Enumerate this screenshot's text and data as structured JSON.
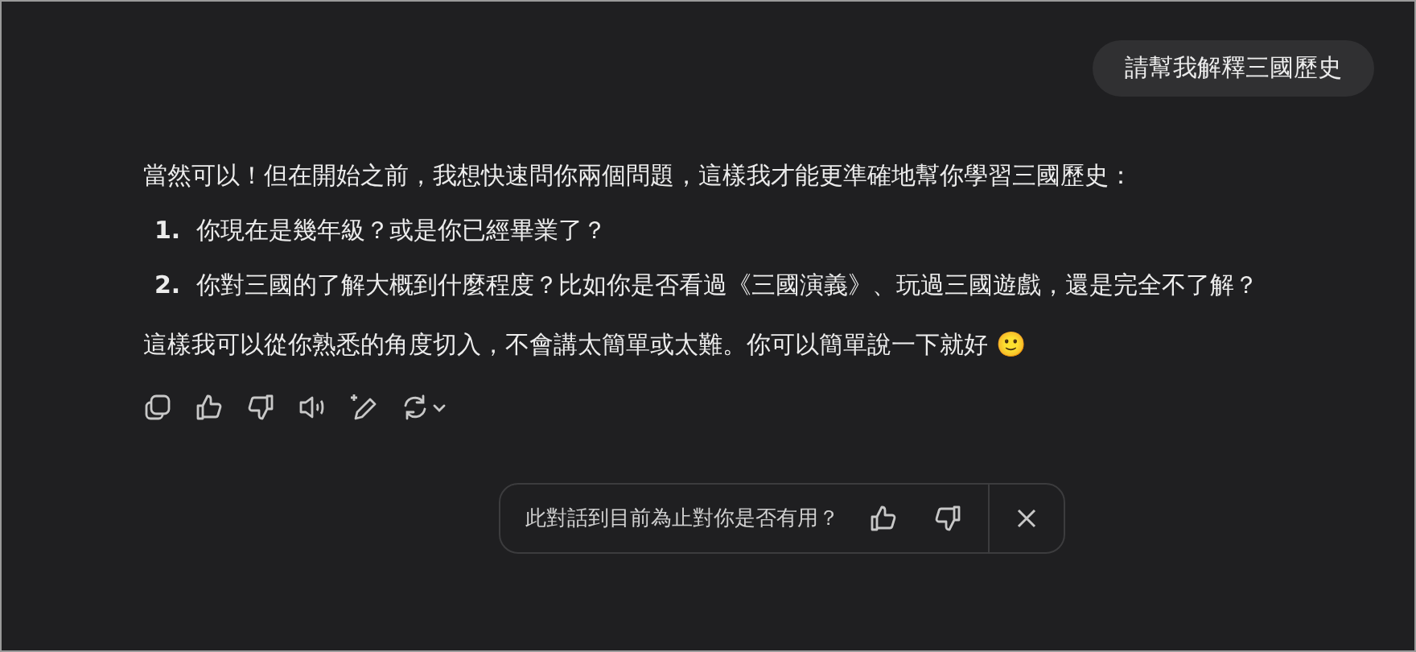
{
  "user_message": {
    "text": "請幫我解釋三國歷史"
  },
  "assistant_message": {
    "intro": "當然可以！但在開始之前，我想快速問你兩個問題，這樣我才能更準確地幫你學習三國歷史：",
    "questions": [
      {
        "number": "1.",
        "text": "你現在是幾年級？或是你已經畢業了？"
      },
      {
        "number": "2.",
        "text": "你對三國的了解大概到什麼程度？比如你是否看過《三國演義》、玩過三國遊戲，還是完全不了解？"
      }
    ],
    "closing": "這樣我可以從你熟悉的角度切入，不會講太簡單或太難。你可以簡單說一下就好 🙂"
  },
  "feedback_bar": {
    "question": "此對話到目前為止對你是否有用？"
  }
}
